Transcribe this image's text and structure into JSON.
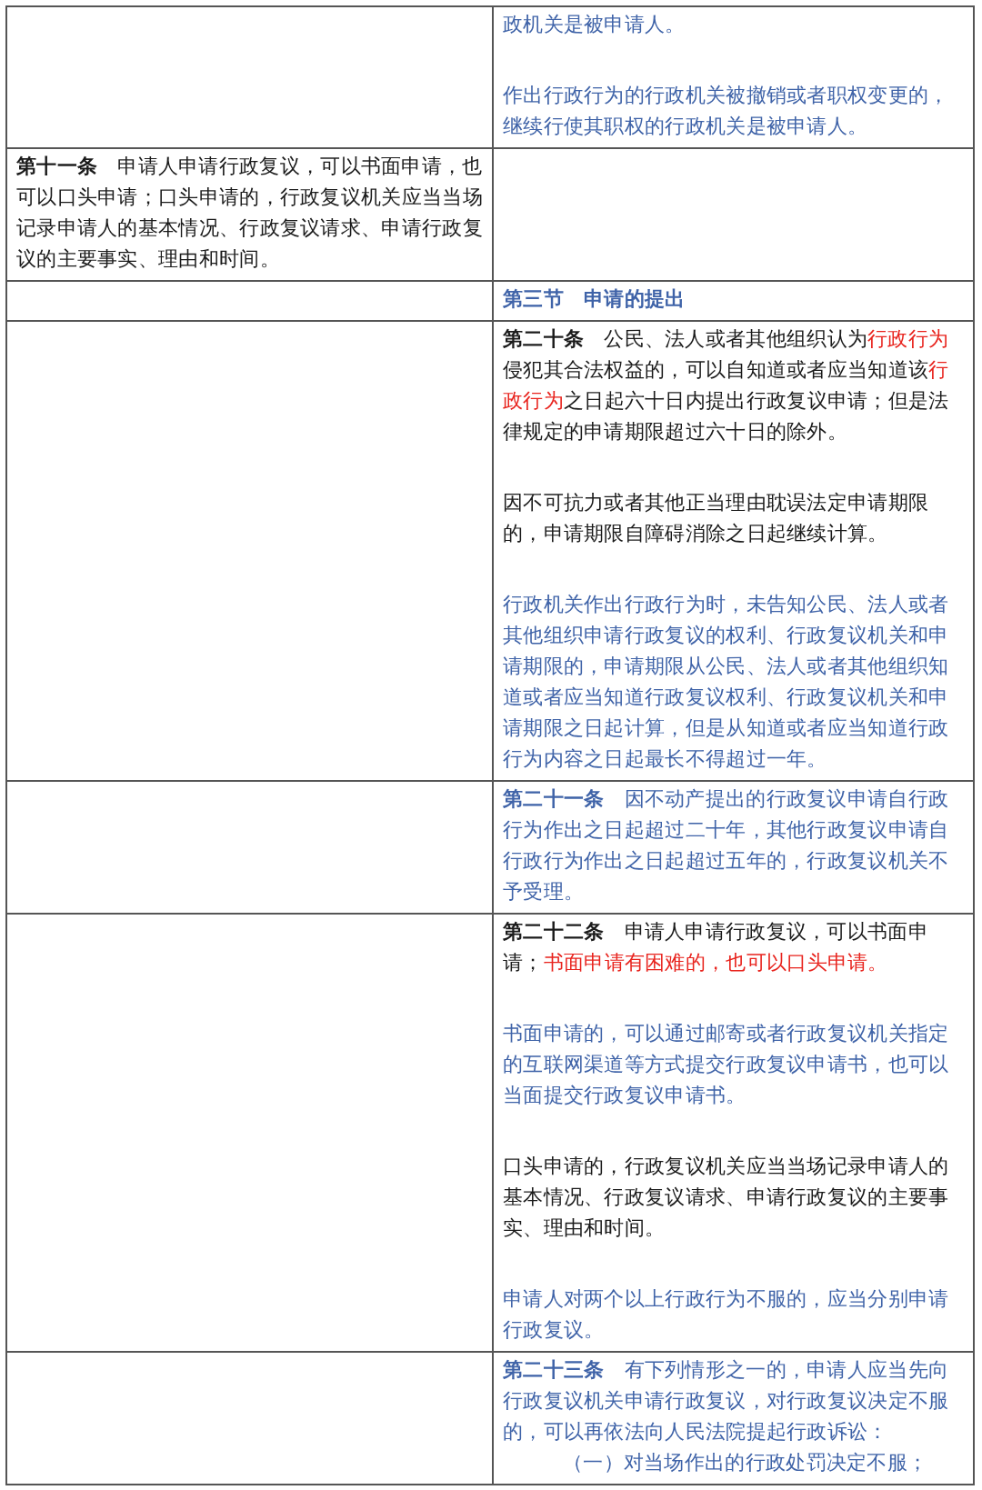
{
  "table": {
    "rows": [
      {
        "left": [],
        "right": [
          {
            "added": true,
            "parts": [
              {
                "kind": "text",
                "text": "政机关是被申请人。"
              }
            ]
          },
          {
            "added": true,
            "parts": [
              {
                "kind": "text",
                "text": "作出行政行为的行政机关被撤销或者职权变更的，继续行使其职权的行政机关是被申请人。"
              }
            ]
          }
        ]
      },
      {
        "left": [
          {
            "added": false,
            "parts": [
              {
                "kind": "lead",
                "text": "第十一条"
              },
              {
                "kind": "text",
                "text": "申请人申请行政复议，可以书面申请，也可以口头申请；口头申请的，行政复议机关应当当场记录申请人的基本情况、行政复议请求、申请行政复议的主要事实、理由和时间。"
              }
            ]
          }
        ],
        "right": []
      },
      {
        "left": [],
        "right": [
          {
            "added": true,
            "parts": [
              {
                "kind": "lead",
                "text": "第三节　申请的提出"
              }
            ]
          }
        ]
      },
      {
        "left": [],
        "right": [
          {
            "added": false,
            "parts": [
              {
                "kind": "lead",
                "text": "第二十条"
              },
              {
                "kind": "text",
                "text": "公民、法人或者其他组织认为"
              },
              {
                "kind": "red",
                "text": "行政行为"
              },
              {
                "kind": "text",
                "text": "侵犯其合法权益的，可以自知道或者应当知道该"
              },
              {
                "kind": "red",
                "text": "行政行为"
              },
              {
                "kind": "text",
                "text": "之日起六十日内提出行政复议申请；但是法律规定的申请期限超过六十日的除外。"
              }
            ]
          },
          {
            "added": false,
            "parts": [
              {
                "kind": "text",
                "text": "因不可抗力或者其他正当理由耽误法定申请期限的，申请期限自障碍消除之日起继续计算。"
              }
            ]
          },
          {
            "added": true,
            "parts": [
              {
                "kind": "text",
                "text": "行政机关作出行政行为时，未告知公民、法人或者其他组织申请行政复议的权利、行政复议机关和申请期限的，申请期限从公民、法人或者其他组织知道或者应当知道行政复议权利、行政复议机关和申请期限之日起计算，但是从知道或者应当知道行政行为内容之日起最长不得超过一年。"
              }
            ]
          }
        ]
      },
      {
        "left": [],
        "right": [
          {
            "added": true,
            "parts": [
              {
                "kind": "lead",
                "text": "第二十一条"
              },
              {
                "kind": "text",
                "text": "因不动产提出的行政复议申请自行政行为作出之日起超过二十年，其他行政复议申请自行政行为作出之日起超过五年的，行政复议机关不予受理。"
              }
            ]
          }
        ]
      },
      {
        "left": [],
        "right": [
          {
            "added": false,
            "parts": [
              {
                "kind": "lead",
                "text": "第二十二条"
              },
              {
                "kind": "text",
                "text": "申请人申请行政复议，可以书面申请；"
              },
              {
                "kind": "red",
                "text": "书面申请有困难的，也可以口头申请。"
              }
            ]
          },
          {
            "added": true,
            "parts": [
              {
                "kind": "text",
                "text": "书面申请的，可以通过邮寄或者行政复议机关指定的互联网渠道等方式提交行政复议申请书，也可以当面提交行政复议申请书。"
              }
            ]
          },
          {
            "added": false,
            "parts": [
              {
                "kind": "text",
                "text": "口头申请的，行政复议机关应当当场记录申请人的基本情况、行政复议请求、申请行政复议的主要事实、理由和时间。"
              }
            ]
          },
          {
            "added": true,
            "parts": [
              {
                "kind": "text",
                "text": "申请人对两个以上行政行为不服的，应当分别申请行政复议。"
              }
            ]
          }
        ]
      },
      {
        "left": [],
        "right": [
          {
            "added": true,
            "parts": [
              {
                "kind": "lead",
                "text": "第二十三条"
              },
              {
                "kind": "text",
                "text": "有下列情形之一的，申请人应当先向行政复议机关申请行政复议，对行政复议决定不服的，可以再依法向人民法院提起行政诉讼："
              }
            ]
          },
          {
            "added": true,
            "kind": "item",
            "parts": [
              {
                "kind": "text",
                "text": "（一）对当场作出的行政处罚决定不服；"
              }
            ]
          }
        ]
      }
    ]
  }
}
